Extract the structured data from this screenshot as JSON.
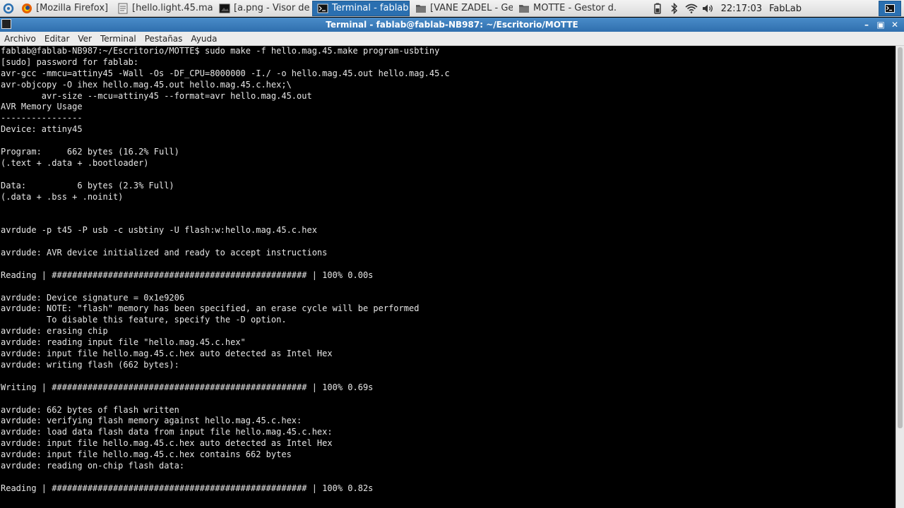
{
  "panel": {
    "tasks": [
      {
        "label": "[Mozilla Firefox]",
        "icon": "firefox-icon",
        "active": false
      },
      {
        "label": "[hello.light.45.ma...",
        "icon": "text-editor-icon",
        "active": false
      },
      {
        "label": "[a.png - Visor de i...",
        "icon": "image-viewer-icon",
        "active": false
      },
      {
        "label": "Terminal - fablab@...",
        "icon": "terminal-icon",
        "active": true
      },
      {
        "label": "[VANE ZADEL - Ges...",
        "icon": "folder-icon",
        "active": false
      },
      {
        "label": "MOTTE - Gestor d...",
        "icon": "folder-icon",
        "active": false
      }
    ],
    "clock": "22:17:03",
    "username": "FabLab",
    "colors": {
      "accent": "#2a6fb0"
    }
  },
  "window": {
    "title": "Terminal - fablab@fablab-NB987: ~/Escritorio/MOTTE"
  },
  "menubar": {
    "items": [
      "Archivo",
      "Editar",
      "Ver",
      "Terminal",
      "Pestañas",
      "Ayuda"
    ]
  },
  "terminal": {
    "lines": [
      "fablab@fablab-NB987:~/Escritorio/MOTTE$ sudo make -f hello.mag.45.make program-usbtiny",
      "[sudo] password for fablab:",
      "avr-gcc -mmcu=attiny45 -Wall -Os -DF_CPU=8000000 -I./ -o hello.mag.45.out hello.mag.45.c",
      "avr-objcopy -O ihex hello.mag.45.out hello.mag.45.c.hex;\\",
      "        avr-size --mcu=attiny45 --format=avr hello.mag.45.out",
      "AVR Memory Usage",
      "----------------",
      "Device: attiny45",
      "",
      "Program:     662 bytes (16.2% Full)",
      "(.text + .data + .bootloader)",
      "",
      "Data:          6 bytes (2.3% Full)",
      "(.data + .bss + .noinit)",
      "",
      "",
      "avrdude -p t45 -P usb -c usbtiny -U flash:w:hello.mag.45.c.hex",
      "",
      "avrdude: AVR device initialized and ready to accept instructions",
      "",
      "Reading | ################################################## | 100% 0.00s",
      "",
      "avrdude: Device signature = 0x1e9206",
      "avrdude: NOTE: \"flash\" memory has been specified, an erase cycle will be performed",
      "         To disable this feature, specify the -D option.",
      "avrdude: erasing chip",
      "avrdude: reading input file \"hello.mag.45.c.hex\"",
      "avrdude: input file hello.mag.45.c.hex auto detected as Intel Hex",
      "avrdude: writing flash (662 bytes):",
      "",
      "Writing | ################################################## | 100% 0.69s",
      "",
      "avrdude: 662 bytes of flash written",
      "avrdude: verifying flash memory against hello.mag.45.c.hex:",
      "avrdude: load data flash data from input file hello.mag.45.c.hex:",
      "avrdude: input file hello.mag.45.c.hex auto detected as Intel Hex",
      "avrdude: input file hello.mag.45.c.hex contains 662 bytes",
      "avrdude: reading on-chip flash data:",
      "",
      "Reading | ################################################## | 100% 0.82s"
    ]
  }
}
